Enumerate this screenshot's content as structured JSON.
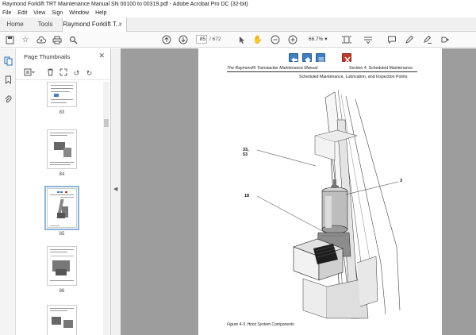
{
  "window": {
    "title": "Raymond Forklift TRT Maintenance Manual SN 00100 to 00319.pdf - Adobe Acrobat Pro DC (32-bit)"
  },
  "menu": [
    "File",
    "Edit",
    "View",
    "Sign",
    "Window",
    "Help"
  ],
  "tabs": {
    "home": "Home",
    "tools": "Tools",
    "document": "Raymond Forklift T...",
    "close": "×"
  },
  "toolbar": {
    "current_page": "85",
    "total_pages": "/ 672",
    "zoom": "66.7%",
    "zoom_arrow": "▾"
  },
  "panel": {
    "title": "Page Thumbnails",
    "close": "✕",
    "thumbnails": [
      {
        "label": "83",
        "selected": false
      },
      {
        "label": "84",
        "selected": false
      },
      {
        "label": "85",
        "selected": true
      },
      {
        "label": "86",
        "selected": false
      },
      {
        "label": "",
        "selected": false
      }
    ]
  },
  "page": {
    "header_left": "The Raymond® Transtacker Maintenance Manual",
    "header_right": "Section 4.  Scheduled Maintenance",
    "header_sub": "Scheduled Maintenance, Lubrication, and Inspection Points",
    "callouts": {
      "c1": "33,\n53",
      "c2": "3",
      "c3": "18"
    },
    "caption": "Figure 4-3.     Hoist System Components"
  },
  "colors": {
    "accent_blue": "#3f7fc0",
    "viewer_bg": "#9d9d9d",
    "nav_red": "#c0392b"
  }
}
